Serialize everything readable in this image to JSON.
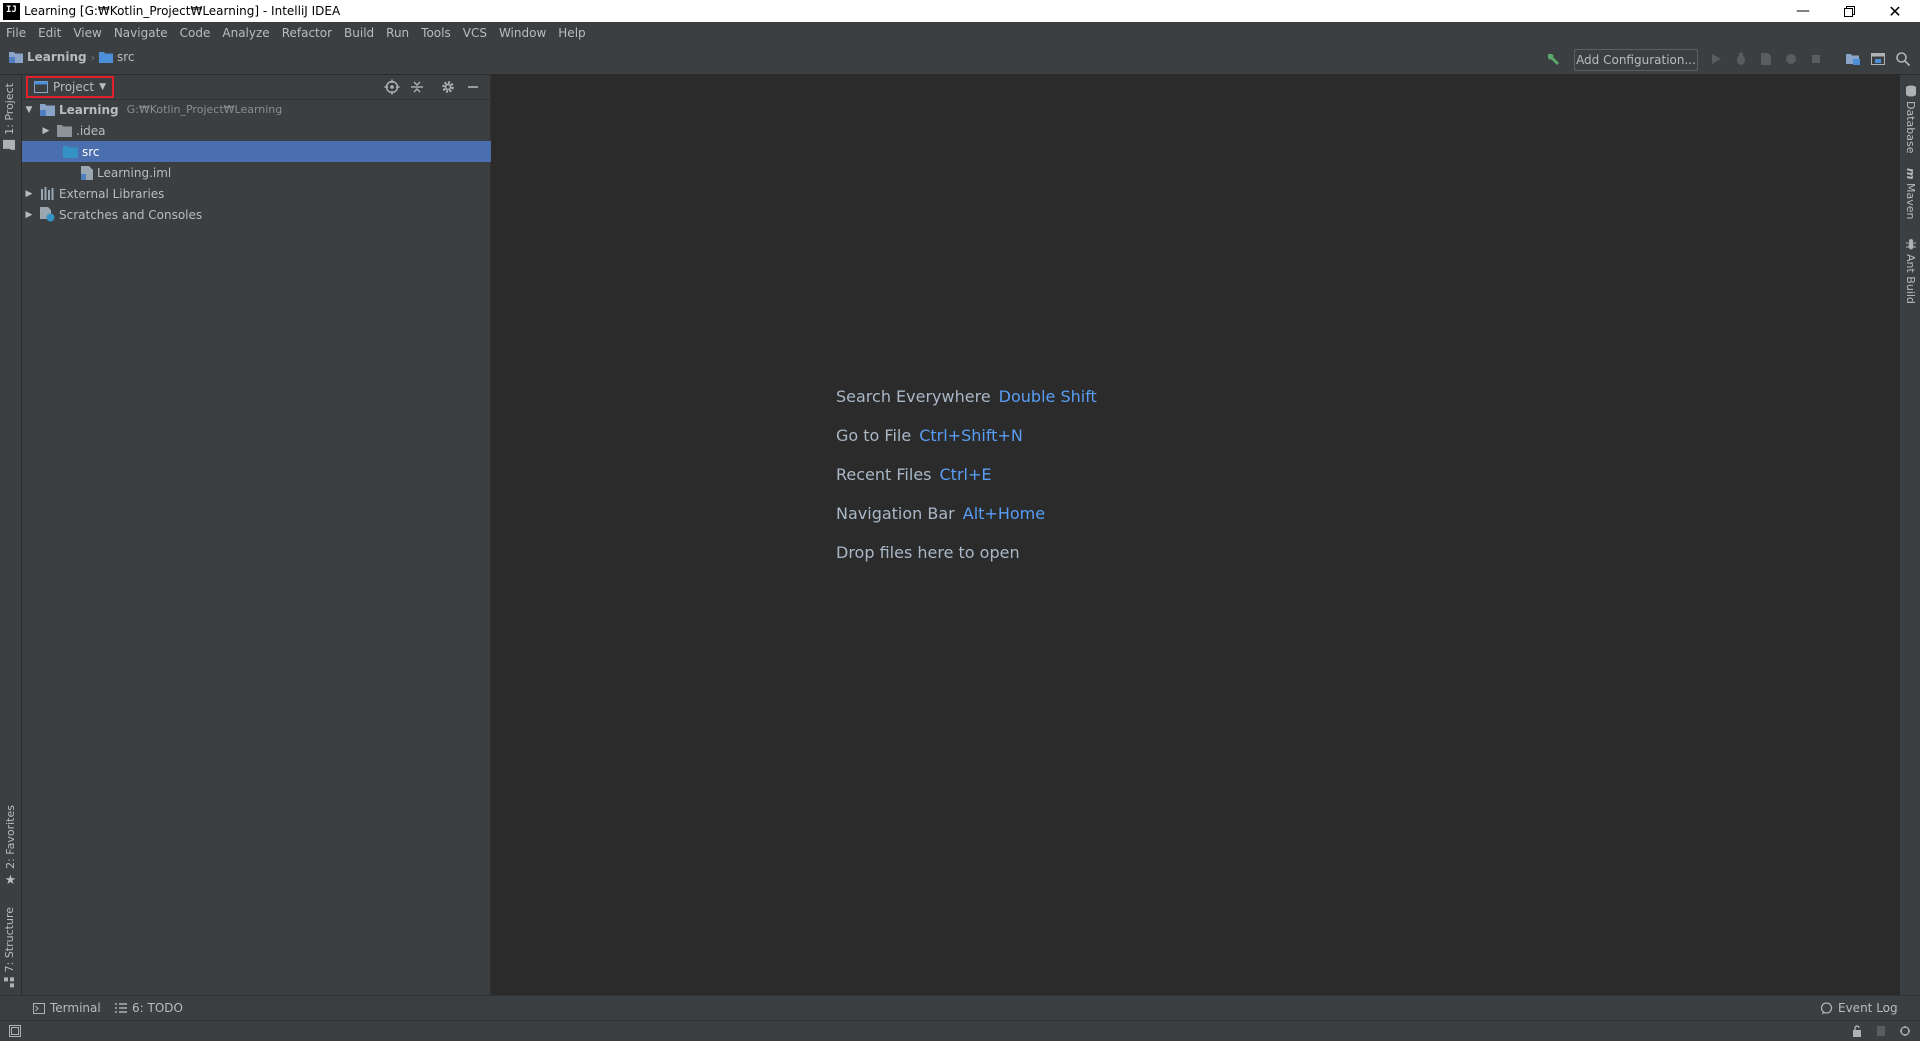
{
  "window": {
    "title": "Learning [G:₩Kotlin_Project₩Learning] - IntelliJ IDEA",
    "icon": "intellij-icon",
    "controls": [
      "minimize",
      "restore",
      "close"
    ]
  },
  "menu": [
    "File",
    "Edit",
    "View",
    "Navigate",
    "Code",
    "Analyze",
    "Refactor",
    "Build",
    "Run",
    "Tools",
    "VCS",
    "Window",
    "Help"
  ],
  "navbar": {
    "breadcrumbs": [
      "Learning",
      "src"
    ],
    "add_configuration": "Add Configuration..."
  },
  "left_stripe": {
    "project_tab": "1: Project",
    "favorites_tab": "2: Favorites",
    "structure_tab": "7: Structure"
  },
  "right_stripe": {
    "database_tab": "Database",
    "maven_tab": "Maven",
    "ant_tab": "Ant Build"
  },
  "project_panel": {
    "view_selector": "Project",
    "tree": [
      {
        "label": "Learning",
        "path": "G:₩Kotlin_Project₩Learning",
        "icon": "module-folder-icon",
        "expanded": true
      },
      {
        "label": ".idea",
        "icon": "folder-icon",
        "expanded": false
      },
      {
        "label": "src",
        "icon": "source-folder-icon",
        "selected": true
      },
      {
        "label": "Learning.iml",
        "icon": "iml-file-icon"
      },
      {
        "label": "External Libraries",
        "icon": "libraries-icon",
        "expanded": false
      },
      {
        "label": "Scratches and Consoles",
        "icon": "scratches-icon",
        "expanded": false
      }
    ]
  },
  "editor": {
    "hints": [
      {
        "label": "Search Everywhere",
        "key": "Double Shift"
      },
      {
        "label": "Go to File",
        "key": "Ctrl+Shift+N"
      },
      {
        "label": "Recent Files",
        "key": "Ctrl+E"
      },
      {
        "label": "Navigation Bar",
        "key": "Alt+Home"
      },
      {
        "label": "Drop files here to open",
        "key": ""
      }
    ]
  },
  "bottom_tools": {
    "terminal": "Terminal",
    "todo": "6: TODO",
    "event_log": "Event Log"
  },
  "colors": {
    "accent_selection": "#4b6eaf",
    "shortcut_key": "#589df6",
    "highlight_box": "#e0202a"
  }
}
